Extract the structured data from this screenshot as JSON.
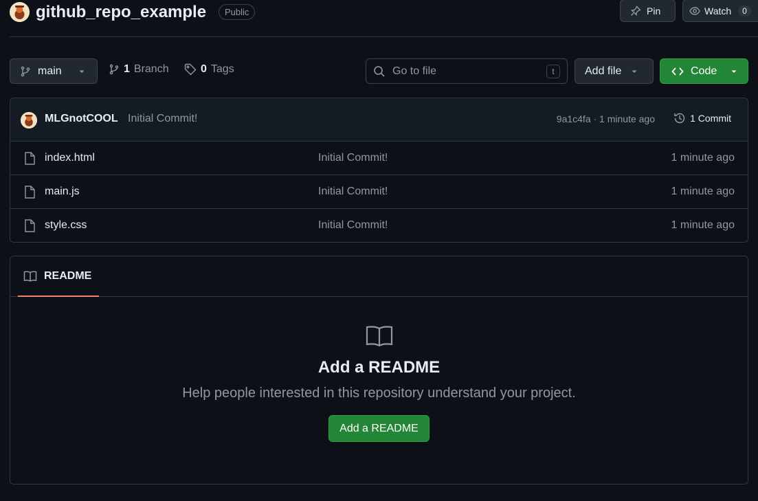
{
  "repo": {
    "name": "github_repo_example",
    "visibility": "Public"
  },
  "header": {
    "pin_label": "Pin",
    "watch_label": "Watch",
    "watch_count": "0"
  },
  "toolbar": {
    "branch": "main",
    "branch_count": "1",
    "branch_label": "Branch",
    "tag_count": "0",
    "tag_label": "Tags",
    "search_placeholder": "Go to file",
    "search_shortcut": "t",
    "add_file_label": "Add file",
    "code_label": "Code"
  },
  "latest_commit": {
    "author": "MLGnotCOOL",
    "message": "Initial Commit!",
    "info": "9a1c4fa · 1 minute ago",
    "count_label": "1 Commit"
  },
  "files": [
    {
      "name": "index.html",
      "commit": "Initial Commit!",
      "age": "1 minute ago"
    },
    {
      "name": "main.js",
      "commit": "Initial Commit!",
      "age": "1 minute ago"
    },
    {
      "name": "style.css",
      "commit": "Initial Commit!",
      "age": "1 minute ago"
    }
  ],
  "readme": {
    "tab_label": "README",
    "heading": "Add a README",
    "description": "Help people interested in this repository understand your project.",
    "button_label": "Add a README"
  },
  "colors": {
    "background": "#0d1117",
    "border": "#30363d",
    "primary_button": "#238636",
    "active_tab_underline": "#f78166"
  },
  "icons": [
    "avatar",
    "pin-icon",
    "eye-icon",
    "branch-icon",
    "tag-icon",
    "search-icon",
    "caret-down-icon",
    "code-icon",
    "history-icon",
    "file-icon",
    "book-icon"
  ]
}
